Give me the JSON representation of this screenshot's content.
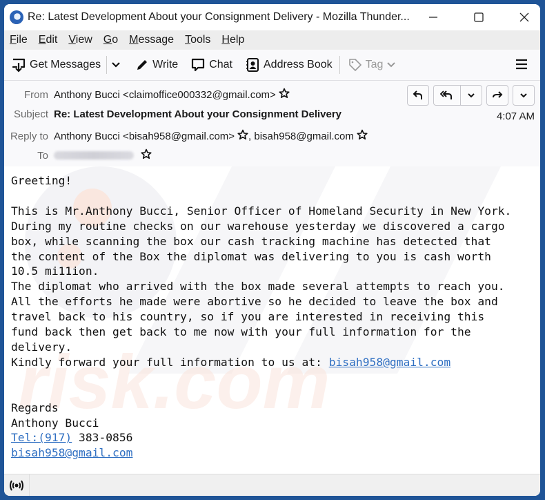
{
  "window": {
    "title": "Re: Latest Development About your Consignment Delivery - Mozilla Thunder...",
    "controls": {
      "minimize": "minimize-icon",
      "maximize": "maximize-icon",
      "close": "close-icon"
    }
  },
  "menubar": {
    "items": [
      {
        "label": "File",
        "accel": "F",
        "rest": "ile"
      },
      {
        "label": "Edit",
        "accel": "E",
        "rest": "dit"
      },
      {
        "label": "View",
        "accel": "V",
        "rest": "iew"
      },
      {
        "label": "Go",
        "accel": "G",
        "rest": "o"
      },
      {
        "label": "Message",
        "accel": "M",
        "rest": "essage"
      },
      {
        "label": "Tools",
        "accel": "T",
        "rest": "ools"
      },
      {
        "label": "Help",
        "accel": "H",
        "rest": "elp"
      }
    ]
  },
  "toolbar": {
    "get_messages": "Get Messages",
    "write": "Write",
    "chat": "Chat",
    "address_book": "Address Book",
    "tag": "Tag"
  },
  "header": {
    "from_label": "From",
    "from_value": "Anthony Bucci <claimoffice000332@gmail.com>",
    "subject_label": "Subject",
    "subject_value": "Re: Latest Development About your Consignment Delivery",
    "time": "4:07 AM",
    "reply_to_label": "Reply to",
    "reply_to_value_1": "Anthony Bucci <bisah958@gmail.com>",
    "reply_to_value_2": ", bisah958@gmail.com",
    "to_label": "To"
  },
  "body": {
    "lines_before_link": "Greeting!\n\nThis is Mr.Anthony Bucci, Senior Officer of Homeland Security in New York.\nDuring my routine checks on our warehouse yesterday we discovered a cargo\nbox, while scanning the box our cash tracking machine has detected that\nthe content of the Box the diplomat was delivering to you is cash worth\n10.5 mi11ion.\nThe diplomat who arrived with the box made several attempts to reach you.\nAll the efforts he made were abortive so he decided to leave the box and\ntravel back to his country, so if you are interested in receiving this\nfund back then get back to me now with your full information for the\ndelivery.\nKindly forward your full information to us at: ",
    "inline_email": "bisah958@gmail.com",
    "signoff": "\n\n\nRegards\nAnthony Bucci\n",
    "tel_link": "Tel:(917)",
    "tel_rest": " 383-0856\n",
    "sig_email": "bisah958@gmail.com"
  },
  "colors": {
    "desktop": "#1f5497",
    "link": "#2f6fc2"
  }
}
